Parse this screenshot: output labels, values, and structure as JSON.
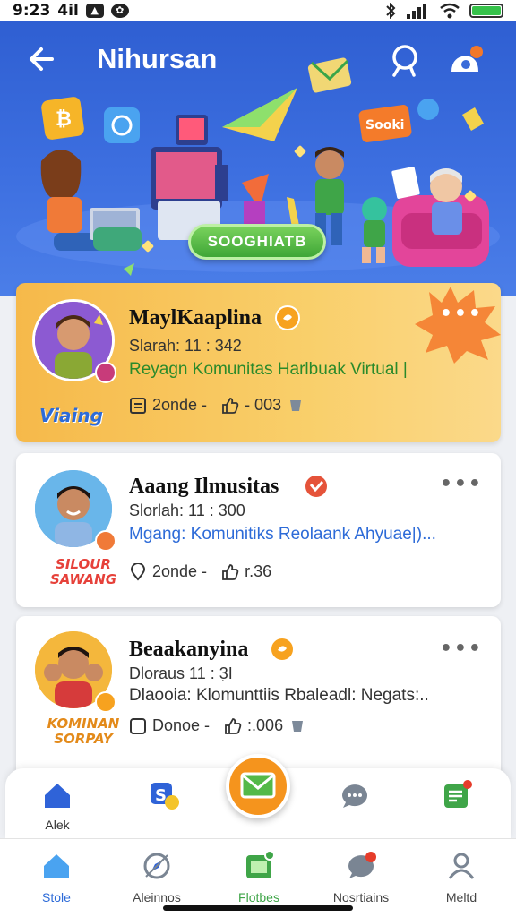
{
  "status_bar": {
    "time": "9:23",
    "signal_text": "4il"
  },
  "header": {
    "title": "Nihursan",
    "cta_label": "SOOGHIATB",
    "sticker_label": "Sooki"
  },
  "posts": [
    {
      "name": "MaylKaaplina",
      "time": "Slarah: 11 : 342",
      "description": "Reyagn Komunitas Harlbuak Virtual |",
      "comments": "2onde -",
      "likes": "- 003",
      "sticker": "Viaing",
      "description_color": "#2a8a2a",
      "featured": true
    },
    {
      "name": "Aaang Ilmusitas",
      "time": "Slorlah: 11 : 300",
      "description": "Mgang: Komunitiks Reolaank Ahyuae|)...",
      "comments": "2onde -",
      "likes": "r.36",
      "sticker": "SILOUR SAWANG",
      "description_color": "#2d6bd8",
      "featured": false
    },
    {
      "name": "Beaakanyina",
      "time": "Dloraus 11 : 3̣I",
      "description": "Dlaooia: Klomunttiis Rbaleadl: Negats:..",
      "comments": "Donoe -",
      "likes": ":.006",
      "sticker": "KOMINAN SORPAY",
      "description_color": "#333333",
      "featured": false
    }
  ],
  "quick_actions": [
    {
      "label": "Alek",
      "icon": "home-icon"
    },
    {
      "label": "",
      "icon": "s-sticker-icon"
    },
    {
      "label": "",
      "icon": "chat-bubble-icon"
    },
    {
      "label": "",
      "icon": "notes-icon"
    }
  ],
  "fab": {
    "icon": "envelope-icon"
  },
  "bottom_nav": [
    {
      "label": "Stole",
      "icon": "home-icon"
    },
    {
      "label": "Aleinnos",
      "icon": "compass-icon"
    },
    {
      "label": "Flotbes",
      "icon": "gallery-icon"
    },
    {
      "label": "Nosrtiains",
      "icon": "notification-icon"
    },
    {
      "label": "Meltd",
      "icon": "profile-icon"
    }
  ],
  "colors": {
    "header_blue": "#3566d8",
    "featured_orange": "#f7c35a",
    "fab_orange": "#f5941d",
    "nav_active": "#2d6bd8"
  }
}
